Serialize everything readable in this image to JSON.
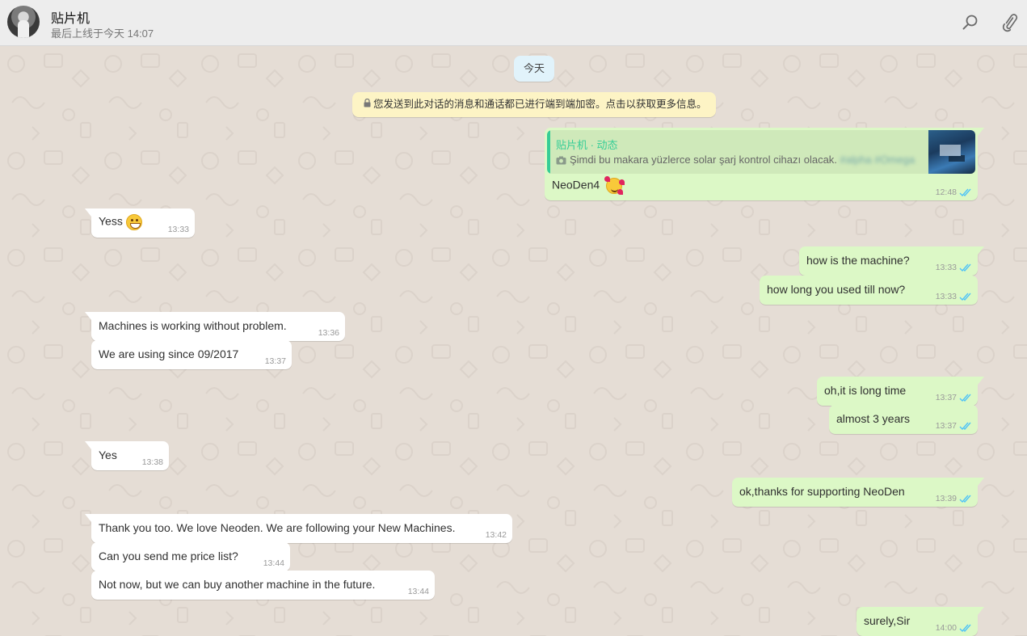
{
  "header": {
    "contact_name": "贴片机",
    "last_seen": "最后上线于今天 14:07"
  },
  "chat": {
    "date_chip": "今天",
    "encryption_notice": "您发送到此对话的消息和通话都已进行端到端加密。点击以获取更多信息。",
    "reply_message": {
      "quoted_author": "贴片机 · 动态",
      "quoted_text": "Şimdi bu makara yüzlerce solar şarj kontrol cihazı olacak.",
      "quoted_hashtags": "#alpha #Omega",
      "text": "NeoDen4",
      "time": "12:48",
      "status": "read"
    },
    "messages": [
      {
        "dir": "in",
        "text": "Yess",
        "emoji": "grin",
        "time": "13:33"
      },
      {
        "dir": "out",
        "text": "how is the machine?",
        "time": "13:33",
        "status": "read"
      },
      {
        "dir": "out",
        "text": "how long you used till now?",
        "time": "13:33",
        "status": "read"
      },
      {
        "dir": "in",
        "text": "Machines is working without problem.",
        "time": "13:36"
      },
      {
        "dir": "in",
        "text": "We are using since 09/2017",
        "time": "13:37"
      },
      {
        "dir": "out",
        "text": "oh,it is long time",
        "time": "13:37",
        "status": "read"
      },
      {
        "dir": "out",
        "text": "almost 3 years",
        "time": "13:37",
        "status": "read"
      },
      {
        "dir": "in",
        "text": "Yes",
        "time": "13:38"
      },
      {
        "dir": "out",
        "text": "ok,thanks for supporting NeoDen",
        "time": "13:39",
        "status": "read"
      },
      {
        "dir": "in",
        "text": "Thank you too. We love Neoden. We are following your New Machines.",
        "time": "13:42"
      },
      {
        "dir": "in",
        "text": "Can you send me price list?",
        "time": "13:44"
      },
      {
        "dir": "in",
        "text": "Not now, but we can buy another machine in the future.",
        "time": "13:44"
      },
      {
        "dir": "out",
        "text": "surely,Sir",
        "time": "14:00",
        "status": "read"
      }
    ]
  },
  "colors": {
    "header_bg": "#ededed",
    "chat_bg": "#e5ddd5",
    "outgoing_bubble": "#dcf8c6",
    "incoming_bubble": "#ffffff",
    "read_ticks": "#4fc3f7",
    "date_chip_bg": "#e1f3fb",
    "notice_bg": "#fdf4c5",
    "quote_accent": "#35cd96"
  },
  "icons": {
    "search": "search-icon",
    "attach": "paperclip-icon",
    "lock": "lock-icon",
    "camera": "camera-icon",
    "read_receipt": "double-check-icon"
  }
}
